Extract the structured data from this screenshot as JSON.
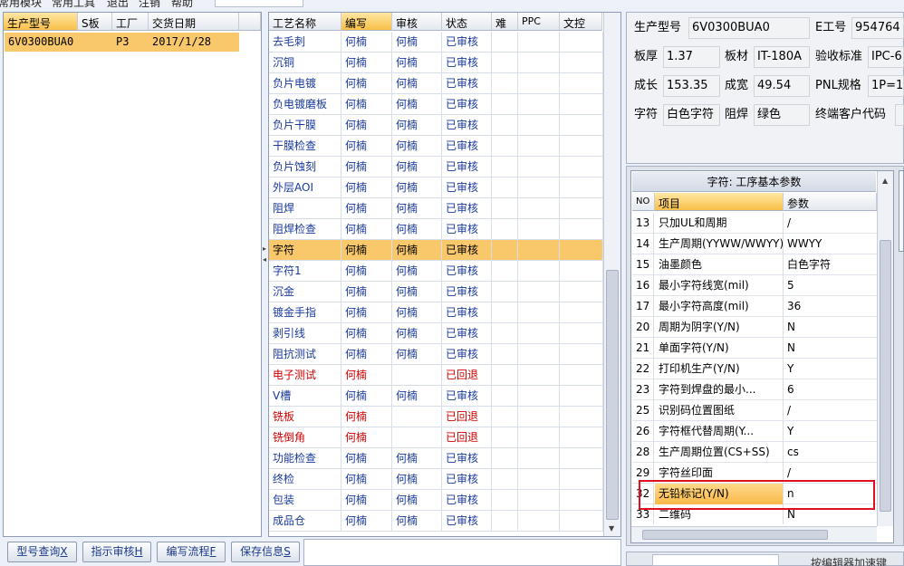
{
  "menu": {
    "items": [
      "常用模块",
      "常用工具",
      "退出",
      "注销",
      "帮助"
    ]
  },
  "product_list": {
    "headers": [
      "生产型号",
      "S板",
      "工厂",
      "交货日期"
    ],
    "rows": [
      {
        "model": "6V0300BUA0",
        "s_board": "",
        "factory": "P3",
        "date": "2017/1/28"
      }
    ]
  },
  "process_table": {
    "headers": [
      "工艺名称",
      "编写",
      "审核",
      "状态",
      "难",
      "PPC",
      "文控"
    ],
    "selected_row": 10,
    "rows": [
      {
        "name": "去毛刺",
        "writer": "何楠",
        "reviewer": "何楠",
        "status": "已审核",
        "color": "blue"
      },
      {
        "name": "沉铜",
        "writer": "何楠",
        "reviewer": "何楠",
        "status": "已审核",
        "color": "blue"
      },
      {
        "name": "负片电镀",
        "writer": "何楠",
        "reviewer": "何楠",
        "status": "已审核",
        "color": "blue"
      },
      {
        "name": "负电镀磨板",
        "writer": "何楠",
        "reviewer": "何楠",
        "status": "已审核",
        "color": "blue"
      },
      {
        "name": "负片干膜",
        "writer": "何楠",
        "reviewer": "何楠",
        "status": "已审核",
        "color": "blue"
      },
      {
        "name": "干膜检查",
        "writer": "何楠",
        "reviewer": "何楠",
        "status": "已审核",
        "color": "blue"
      },
      {
        "name": "负片蚀刻",
        "writer": "何楠",
        "reviewer": "何楠",
        "status": "已审核",
        "color": "blue"
      },
      {
        "name": "外层AOI",
        "writer": "何楠",
        "reviewer": "何楠",
        "status": "已审核",
        "color": "blue"
      },
      {
        "name": "阻焊",
        "writer": "何楠",
        "reviewer": "何楠",
        "status": "已审核",
        "color": "blue"
      },
      {
        "name": "阻焊检查",
        "writer": "何楠",
        "reviewer": "何楠",
        "status": "已审核",
        "color": "blue"
      },
      {
        "name": "字符",
        "writer": "何楠",
        "reviewer": "何楠",
        "status": "已审核",
        "color": "black"
      },
      {
        "name": "字符1",
        "writer": "何楠",
        "reviewer": "何楠",
        "status": "已审核",
        "color": "blue"
      },
      {
        "name": "沉金",
        "writer": "何楠",
        "reviewer": "何楠",
        "status": "已审核",
        "color": "blue"
      },
      {
        "name": "镀金手指",
        "writer": "何楠",
        "reviewer": "何楠",
        "status": "已审核",
        "color": "blue"
      },
      {
        "name": "剥引线",
        "writer": "何楠",
        "reviewer": "何楠",
        "status": "已审核",
        "color": "blue"
      },
      {
        "name": "阻抗测试",
        "writer": "何楠",
        "reviewer": "何楠",
        "status": "已审核",
        "color": "blue"
      },
      {
        "name": "电子测试",
        "writer": "何楠",
        "reviewer": "",
        "status": "已回退",
        "color": "red"
      },
      {
        "name": "V槽",
        "writer": "何楠",
        "reviewer": "何楠",
        "status": "已审核",
        "color": "blue"
      },
      {
        "name": "铣板",
        "writer": "何楠",
        "reviewer": "",
        "status": "已回退",
        "color": "red"
      },
      {
        "name": "铣倒角",
        "writer": "何楠",
        "reviewer": "",
        "status": "已回退",
        "color": "red"
      },
      {
        "name": "功能检查",
        "writer": "何楠",
        "reviewer": "何楠",
        "status": "已审核",
        "color": "blue"
      },
      {
        "name": "终检",
        "writer": "何楠",
        "reviewer": "何楠",
        "status": "已审核",
        "color": "blue"
      },
      {
        "name": "包装",
        "writer": "何楠",
        "reviewer": "何楠",
        "status": "已审核",
        "color": "blue"
      },
      {
        "name": "成品仓",
        "writer": "何楠",
        "reviewer": "何楠",
        "status": "已审核",
        "color": "blue"
      }
    ]
  },
  "buttons": {
    "model_query": "型号查询",
    "model_query_key": "X",
    "instruction_review": "指示审核",
    "instruction_review_key": "H",
    "write_flow": "编写流程",
    "write_flow_key": "F",
    "save_info": "保存信息",
    "save_info_key": "S"
  },
  "info": {
    "model_label": "生产型号",
    "model_value": "6V0300BUA0",
    "e_label": "E工号",
    "e_value": "954764",
    "thickness_label": "板厚",
    "thickness_value": "1.37",
    "material_label": "板材",
    "material_value": "IT-180A",
    "standard_label": "验收标准",
    "standard_value": "IPC-6",
    "length_label": "成长",
    "length_value": "153.35",
    "width_label": "成宽",
    "width_value": "49.54",
    "pnl_label": "PNL规格",
    "pnl_value": "1P=1",
    "char_label": "字符",
    "char_value": "白色字符",
    "mask_label": "阻焊",
    "mask_value": "绿色",
    "customer_label": "终端客户代码",
    "customer_value": ""
  },
  "params": {
    "title": "字符: 工序基本参数",
    "headers": [
      "NO",
      "项目",
      "参数"
    ],
    "selected_row": 13,
    "rows": [
      {
        "no": "13",
        "item": "只加UL和周期",
        "param": "/"
      },
      {
        "no": "14",
        "item": "生产周期(YYWW/WWYY)",
        "param": "WWYY"
      },
      {
        "no": "15",
        "item": "油墨颜色",
        "param": "白色字符"
      },
      {
        "no": "16",
        "item": "最小字符线宽(mil)",
        "param": "5"
      },
      {
        "no": "17",
        "item": "最小字符高度(mil)",
        "param": "36"
      },
      {
        "no": "20",
        "item": "周期为阴字(Y/N)",
        "param": "N"
      },
      {
        "no": "21",
        "item": "单面字符(Y/N)",
        "param": "N"
      },
      {
        "no": "22",
        "item": "打印机生产(Y/N)",
        "param": "Y"
      },
      {
        "no": "23",
        "item": "字符到焊盘的最小...",
        "param": "6"
      },
      {
        "no": "25",
        "item": "识别码位置图纸",
        "param": "/"
      },
      {
        "no": "26",
        "item": "字符框代替周期(Y...",
        "param": "Y"
      },
      {
        "no": "28",
        "item": "生产周期位置(CS+SS)",
        "param": "cs"
      },
      {
        "no": "29",
        "item": "字符丝印面",
        "param": "/"
      },
      {
        "no": "32",
        "item": "无铅标记(Y/N)",
        "param": "n"
      },
      {
        "no": "33",
        "item": "二维码",
        "param": "N"
      }
    ]
  },
  "status": {
    "text": "按编辑器加速键"
  }
}
